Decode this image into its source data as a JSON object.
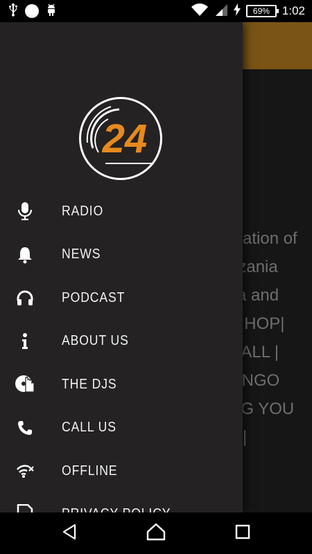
{
  "status_bar": {
    "battery": "69%",
    "time": "1:02"
  },
  "main_text": {
    "lines": [
      "mation of",
      "nzania",
      "ca and",
      "P HOP|",
      "HALL |",
      "ONGO",
      "NG YOU",
      "M|"
    ]
  },
  "drawer": {
    "logo_text": "24",
    "items": [
      {
        "label": "RADIO",
        "icon": "microphone-icon"
      },
      {
        "label": "NEWS",
        "icon": "bell-icon"
      },
      {
        "label": "PODCAST",
        "icon": "headphones-icon"
      },
      {
        "label": "ABOUT US",
        "icon": "info-icon"
      },
      {
        "label": "THE DJS",
        "icon": "dj-hand-icon"
      },
      {
        "label": "CALL US",
        "icon": "phone-icon"
      },
      {
        "label": "OFFLINE",
        "icon": "wifi-off-icon"
      },
      {
        "label": "PRIVACY POLICY",
        "icon": "document-icon"
      }
    ]
  },
  "colors": {
    "drawer_bg": "#242223",
    "header_bg": "#7a5416",
    "logo_orange": "#e68a1e"
  }
}
